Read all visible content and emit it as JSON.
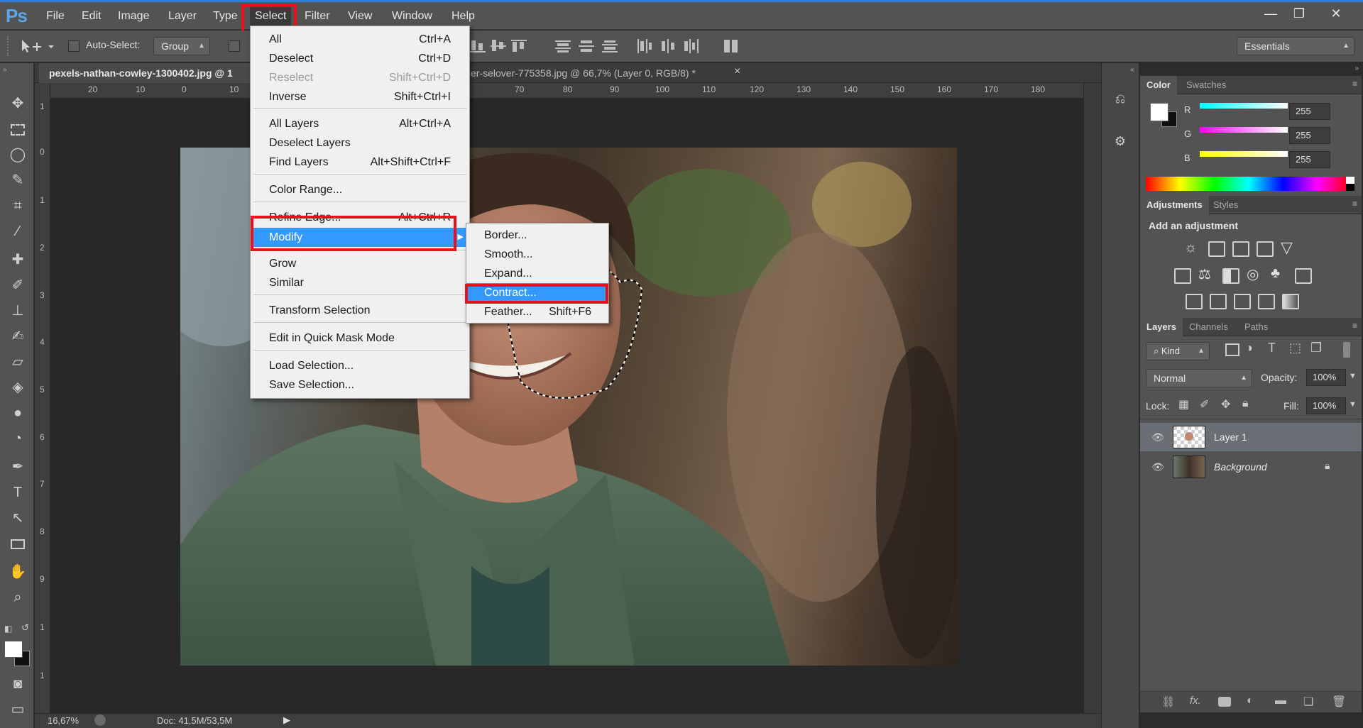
{
  "app": {
    "logo": "Ps"
  },
  "menubar": {
    "items": [
      "File",
      "Edit",
      "Image",
      "Layer",
      "Type",
      "Select",
      "Filter",
      "View",
      "Window",
      "Help"
    ],
    "active": "Select"
  },
  "window_controls": {
    "minimize": "—",
    "restore": "❐",
    "close": "✕"
  },
  "options_bar": {
    "auto_select_label": "Auto-Select:",
    "auto_select_value": "Group",
    "workspace": "Essentials"
  },
  "document": {
    "tabs": [
      {
        "label": "pexels-nathan-cowley-1300402.jpg @ 1",
        "active": true
      },
      {
        "label": "er-selover-775358.jpg @ 66,7% (Layer 0, RGB/8) *",
        "active": false
      }
    ],
    "tab_close": "×",
    "ruler_h": [
      "20",
      "10",
      "0",
      "10",
      "70",
      "80",
      "90",
      "100",
      "110",
      "120",
      "130",
      "140",
      "150",
      "160",
      "170",
      "180"
    ],
    "ruler_v": [
      "1",
      "0",
      "1",
      "2",
      "3",
      "4",
      "5",
      "6",
      "7",
      "8",
      "9",
      "1",
      "1",
      "1"
    ]
  },
  "status": {
    "zoom": "16,67%",
    "doc": "Doc: 41,5M/53,5M"
  },
  "select_menu": {
    "items": [
      {
        "label": "All",
        "shortcut": "Ctrl+A"
      },
      {
        "label": "Deselect",
        "shortcut": "Ctrl+D"
      },
      {
        "label": "Reselect",
        "shortcut": "Shift+Ctrl+D",
        "disabled": true
      },
      {
        "label": "Inverse",
        "shortcut": "Shift+Ctrl+I"
      },
      {
        "label": "All Layers",
        "shortcut": "Alt+Ctrl+A"
      },
      {
        "label": "Deselect Layers",
        "shortcut": ""
      },
      {
        "label": "Find Layers",
        "shortcut": "Alt+Shift+Ctrl+F"
      },
      {
        "label": "Color Range...",
        "shortcut": ""
      },
      {
        "label": "Refine Edge...",
        "shortcut": "Alt+Ctrl+R"
      },
      {
        "label": "Modify",
        "shortcut": ""
      },
      {
        "label": "Grow",
        "shortcut": ""
      },
      {
        "label": "Similar",
        "shortcut": ""
      },
      {
        "label": "Transform Selection",
        "shortcut": ""
      },
      {
        "label": "Edit in Quick Mask Mode",
        "shortcut": ""
      },
      {
        "label": "Load Selection...",
        "shortcut": ""
      },
      {
        "label": "Save Selection...",
        "shortcut": ""
      }
    ]
  },
  "modify_submenu": {
    "items": [
      {
        "label": "Border...",
        "shortcut": ""
      },
      {
        "label": "Smooth...",
        "shortcut": ""
      },
      {
        "label": "Expand...",
        "shortcut": ""
      },
      {
        "label": "Contract...",
        "shortcut": ""
      },
      {
        "label": "Feather...",
        "shortcut": "Shift+F6"
      }
    ]
  },
  "color_panel": {
    "tabs": [
      "Color",
      "Swatches"
    ],
    "channels": [
      {
        "name": "R",
        "value": "255"
      },
      {
        "name": "G",
        "value": "255"
      },
      {
        "name": "B",
        "value": "255"
      }
    ]
  },
  "adjustments_panel": {
    "tabs": [
      "Adjustments",
      "Styles"
    ],
    "title": "Add an adjustment"
  },
  "layers_panel": {
    "tabs": [
      "Layers",
      "Channels",
      "Paths"
    ],
    "kind_filter": "Kind",
    "blend_mode": "Normal",
    "opacity_label": "Opacity:",
    "opacity": "100%",
    "lock_label": "Lock:",
    "fill_label": "Fill:",
    "fill": "100%",
    "layers": [
      {
        "name": "Layer 1",
        "selected": true
      },
      {
        "name": "Background",
        "selected": false
      }
    ],
    "footer_fx": "fx."
  },
  "colors": {
    "accent": "#2f7fd6",
    "highlight": "#3399ff",
    "annotation_red": "#e8101c"
  }
}
